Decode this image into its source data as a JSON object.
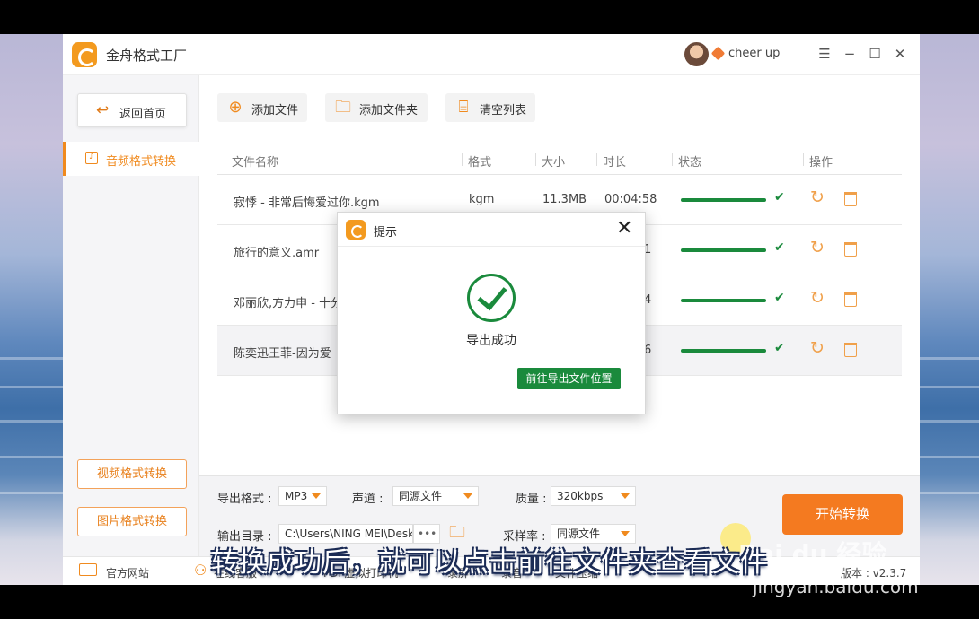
{
  "app": {
    "title": "金舟格式工厂",
    "username": "cheer up"
  },
  "sidebar": {
    "back_label": "返回首页",
    "active_item": "音频格式转换",
    "video_btn": "视频格式转换",
    "image_btn": "图片格式转换"
  },
  "toolbar": {
    "add_file": "添加文件",
    "add_folder": "添加文件夹",
    "clear_list": "清空列表"
  },
  "table": {
    "headers": {
      "name": "文件名称",
      "format": "格式",
      "size": "大小",
      "duration": "时长",
      "status": "状态",
      "action": "操作"
    },
    "rows": [
      {
        "name": "寂悸 - 非常后悔爱过你.kgm",
        "format": "kgm",
        "size": "11.3MB",
        "duration": "00:04:58",
        "duration_visible": "00:04:58",
        "progress": 1.0
      },
      {
        "name": "旅行的意义.amr",
        "format": "",
        "size": "",
        "duration": "",
        "duration_visible": "1",
        "progress": 1.0
      },
      {
        "name": "邓丽欣,方力申 - 十分",
        "format": "",
        "size": "",
        "duration": "",
        "duration_visible": "4",
        "progress": 1.0
      },
      {
        "name": "陈奕迅王菲-因为爱",
        "format": "",
        "size": "",
        "duration": "",
        "duration_visible": "6",
        "progress": 1.0
      }
    ]
  },
  "bottom": {
    "export_format_label": "导出格式 :",
    "export_format": "MP3",
    "channel_label": "声道 :",
    "channel": "同源文件",
    "quality_label": "质量 :",
    "quality": "320kbps",
    "output_dir_label": "输出目录 :",
    "output_dir": "C:\\Users\\NING MEI\\Desk",
    "dots": "•••",
    "sample_rate_label": "采样率 :",
    "sample_rate": "同源文件",
    "start_label": "开始转换"
  },
  "statusbar": {
    "website": "官方网站",
    "service": "在线客服",
    "printer": "PDF虚拟打印机",
    "record_screen": "录屏",
    "record_audio": "录音",
    "compress": "文件压缩",
    "version": "版本 : v2.3.7"
  },
  "dialog": {
    "title": "提示",
    "message": "导出成功",
    "button": "前往导出文件位置"
  },
  "overlay": {
    "subtitle": "转换成功后，就可以点击前往文件夹查看文件",
    "watermark": "Bai du 经验",
    "watermark_url": "jingyan.baidu.com"
  }
}
